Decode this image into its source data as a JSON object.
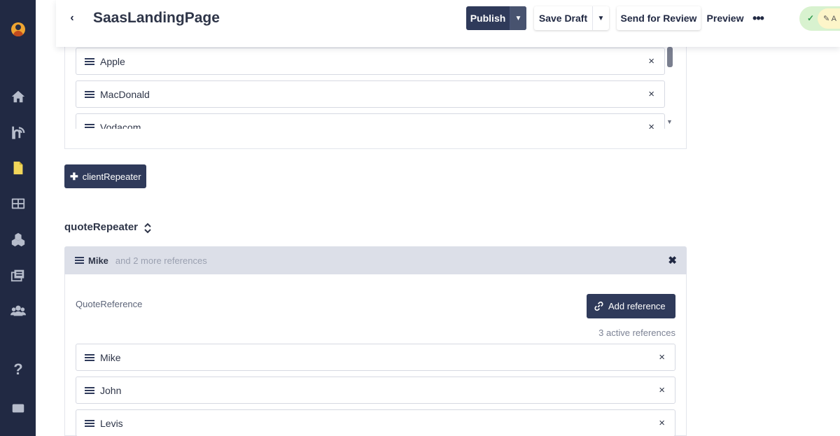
{
  "header": {
    "title": "SaasLandingPage",
    "back_glyph": "‹",
    "publish_label": "Publish",
    "save_draft_label": "Save Draft",
    "send_review_label": "Send for Review",
    "preview_label": "Preview",
    "more_glyph": "•••",
    "status_check_glyph": "✓",
    "status_edit_text": "✎ A"
  },
  "sidebar": {
    "icons": [
      "avatar",
      "home-icon",
      "blog-icon",
      "document-icon",
      "layout-icon",
      "components-icon",
      "media-icon",
      "users-icon",
      "help-icon",
      "chat-icon"
    ],
    "help_glyph": "?"
  },
  "clients": {
    "items": [
      {
        "label": "Apple"
      },
      {
        "label": "MacDonald"
      },
      {
        "label": "Vodacom"
      }
    ],
    "remove_glyph": "×",
    "add_button_label": "clientRepeater",
    "add_glyph": "✚"
  },
  "quotes": {
    "section_title": "quoteRepeater",
    "head_name": "Mike",
    "head_more": "and 2 more references",
    "field_label": "QuoteReference",
    "add_reference_label": "Add reference",
    "active_references": "3 active references",
    "items": [
      {
        "label": "Mike"
      },
      {
        "label": "John"
      },
      {
        "label": "Levis"
      }
    ],
    "close_glyph": "✖",
    "remove_glyph": "×"
  },
  "colors": {
    "sidebar": "#212943",
    "primary_button": "#2f3a5a",
    "quote_header": "#dcdfe8",
    "status_green": "#d8f2cf",
    "status_yellow": "#fdf5c9"
  }
}
